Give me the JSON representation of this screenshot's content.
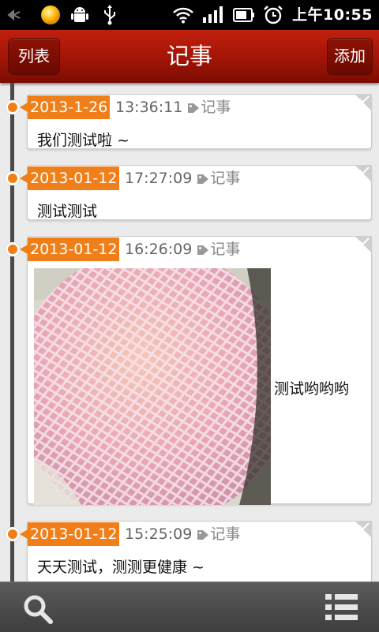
{
  "status_bar": {
    "time": "上午10:55",
    "icons": [
      "usb-debug-icon",
      "notification-orb-icon",
      "android-icon",
      "usb-icon",
      "wifi-icon",
      "signal-icon",
      "battery-icon",
      "alarm-icon"
    ]
  },
  "header": {
    "back_label": "列表",
    "title": "记事",
    "add_label": "添加"
  },
  "colors": {
    "header_red": "#a21406",
    "accent_orange": "#f07f1a",
    "timeline": "#4a4a4a"
  },
  "entries": [
    {
      "date": "2013-1-26",
      "time": "13:36:11",
      "category": "记事",
      "text": "我们测试啦 ~"
    },
    {
      "date": "2013-01-12",
      "time": "17:27:09",
      "category": "记事",
      "text": "测试测试"
    },
    {
      "date": "2013-01-12",
      "time": "16:26:09",
      "category": "记事",
      "text": "测试哟哟哟",
      "has_image": true
    },
    {
      "date": "2013-01-12",
      "time": "15:25:09",
      "category": "记事",
      "text": "天天测试，测测更健康 ~"
    }
  ],
  "bottom_bar": {
    "icons": [
      "search-icon",
      "list-menu-icon"
    ]
  }
}
